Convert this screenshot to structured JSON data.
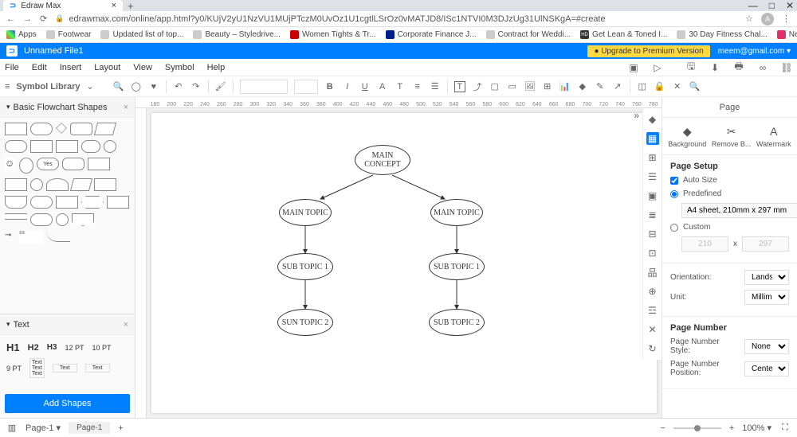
{
  "browser": {
    "tab_title": "Edraw Max",
    "url": "edrawmax.com/online/app.html?y0/KUjV2yU1NzVU1MUjPTczM0UvOz1U1cgtlLSrOz0vMATJD8/ISc1NTVI0M3DJzUg31UlNSKgA=#create",
    "bookmarks": [
      "Apps",
      "Footwear",
      "Updated list of top...",
      "Beauty – Styledrive...",
      "Women Tights & Tr...",
      "Corporate Finance J...",
      "Contract for Weddi...",
      "Get Lean & Toned I...",
      "30 Day Fitness Chal...",
      "Negin Mirsalehi (@..."
    ],
    "avatar_initial": "A"
  },
  "app": {
    "filename": "Unnamed File1",
    "upgrade": "● Upgrade to Premium Version",
    "email": "meem@gmail.com"
  },
  "menus": [
    "File",
    "Edit",
    "Insert",
    "Layout",
    "View",
    "Symbol",
    "Help"
  ],
  "left": {
    "symbol_library": "Symbol Library",
    "shapes_header": "Basic Flowchart Shapes",
    "text_header": "Text",
    "add_shapes": "Add Shapes",
    "h1": "H1",
    "h2": "H2",
    "h3": "H3",
    "pt12": "12 PT",
    "pt10": "10 PT",
    "pt9": "9 PT",
    "text_lbl": "Text"
  },
  "canvas": {
    "nodes": {
      "root": "MAIN CONCEPT",
      "m1": "MAIN TOPIC",
      "m2": "MAIN TOPIC",
      "s1": "SUB TOPIC 1",
      "s2": "SUB TOPIC 1",
      "s3": "SUN TOPIC 2",
      "s4": "SUB TOPIC 2"
    },
    "ruler_ticks": [
      "180",
      "200",
      "220",
      "240",
      "260",
      "280",
      "300",
      "320",
      "340",
      "360",
      "380",
      "400",
      "420",
      "440",
      "460",
      "480",
      "500",
      "520",
      "540",
      "560",
      "580",
      "600",
      "620",
      "640",
      "660",
      "680",
      "700",
      "720",
      "740",
      "760",
      "780"
    ]
  },
  "right": {
    "title": "Page",
    "tabs": {
      "bg": "Background",
      "rb": "Remove B...",
      "wm": "Watermark"
    },
    "setup": "Page Setup",
    "auto_size": "Auto Size",
    "predefined": "Predefined",
    "paper": "A4 sheet, 210mm x 297 mm",
    "custom": "Custom",
    "dim_w": "210",
    "dim_x": "x",
    "dim_h": "297",
    "orientation_lbl": "Orientation:",
    "orientation_val": "Lands...",
    "unit_lbl": "Unit:",
    "unit_val": "Millim...",
    "page_num": "Page Number",
    "pn_style_lbl": "Page Number Style:",
    "pn_style_val": "None",
    "pn_pos_lbl": "Page Number Position:",
    "pn_pos_val": "Center"
  },
  "status": {
    "page_sel": "Page-1",
    "page_tab": "Page-1",
    "zoom": "100%",
    "minus": "−",
    "plus": "+"
  }
}
